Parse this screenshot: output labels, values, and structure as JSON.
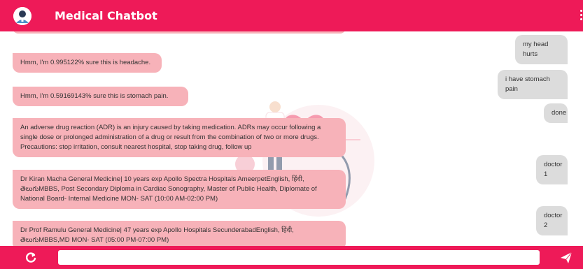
{
  "header": {
    "title": "Medical Chatbot"
  },
  "messages": [
    {
      "from": "user",
      "text": "my head hurts"
    },
    {
      "from": "bot",
      "text": "Hmm, I'm 0.995122% sure this is headache."
    },
    {
      "from": "user",
      "text": "i have stomach pain"
    },
    {
      "from": "bot",
      "text": "Hmm, I'm 0.59169143% sure this is stomach pain."
    },
    {
      "from": "user",
      "text": "done"
    },
    {
      "from": "bot",
      "text": "An adverse drug reaction (ADR) is an injury caused by taking medication. ADRs may occur following a single dose or prolonged administration of a drug or result from the combination of two or more drugs. Precautions: stop irritation, consult nearest hospital, stop taking drug, follow up"
    },
    {
      "from": "user",
      "text": "doctor 1"
    },
    {
      "from": "bot",
      "text": "Dr Kiran Macha General Medicine| 10 years exp Apollo Spectra Hospitals AmeerpetEnglish, हिंदी, తెలుగుMBBS, Post Secondary Diploma in Cardiac Sonography, Master of Public Health, Diplomate of National Board- Internal Medicine MON- SAT (10:00 AM-02:00 PM)"
    },
    {
      "from": "user",
      "text": "doctor 2"
    },
    {
      "from": "bot",
      "text": "Dr Prof Ramulu General Medicine| 47 years exp Apollo Hospitals SecunderabadEnglish, हिंदी, తెలుగుMBBS,MD MON- SAT (05:00 PM-07:00 PM)"
    }
  ],
  "composer": {
    "value": "",
    "placeholder": ""
  },
  "icons": {
    "avatar": "doctor-avatar-icon",
    "refresh": "refresh-icon",
    "send": "send-icon",
    "menu": "more-vertical-icon"
  },
  "colors": {
    "brand": "#ee1a58",
    "bot_bubble": "#f7b2b9",
    "user_bubble": "#dcdcdc"
  }
}
